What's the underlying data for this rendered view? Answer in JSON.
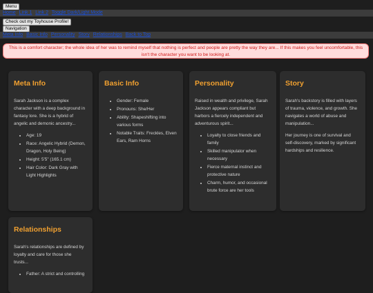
{
  "top": {
    "menu_label": "Menu",
    "links": [
      "Home",
      "Link 1",
      "Link 2",
      "Toggle Dark/Light Mode"
    ],
    "toyhouse_label": "Check out my Toyhouse Profile!",
    "navigation_label": "Navigation",
    "nav_links": [
      "Meta Info",
      "Basic Info",
      "Personality",
      "Story",
      "Relationships",
      "Back to Top"
    ]
  },
  "notice": {
    "text": "This is a comfort character; the whole idea of her was to remind myself that nothing is perfect and people are pretty the way they are... If this makes you feel uncomfortable, this isn't the character you want to be looking at."
  },
  "colors": {
    "background": "#1e1e1e",
    "card": "#2d2d2d",
    "heading": "#f0a030",
    "notice_bg": "#ffdcdc",
    "notice_text": "#d01919",
    "link": "#1a4fd8"
  },
  "cards": {
    "meta": {
      "title": "Meta Info",
      "text": "Sarah Jackson is a complex character with a deep background in fantasy lore. She is a hybrid of angelic and demonic ancestry...",
      "items": [
        "Age: 19",
        "Race: Angelic Hybrid (Demon, Dragon, Holy Being)",
        "Height: 5'5\" (165.1 cm)",
        "Hair Color: Dark Gray with Light Highlights"
      ]
    },
    "basic": {
      "title": "Basic Info",
      "items": [
        "Gender: Female",
        "Pronouns: She/Her",
        "Ability: Shapeshifting into various forms",
        "Notable Traits: Freckles, Elven Ears, Ram Horns"
      ]
    },
    "personality": {
      "title": "Personality",
      "text": "Raised in wealth and privilege, Sarah Jackson appears compliant but harbors a fiercely independent and adventurous spirit...",
      "items": [
        "Loyalty to close friends and family",
        "Skilled manipulator when necessary",
        "Fierce maternal instinct and protective nature",
        "Charm, humor, and occasional brute force are her tools"
      ]
    },
    "story": {
      "title": "Story",
      "text1": "Sarah's backstory is filled with layers of trauma, violence, and growth. She navigates a world of abuse and manipulation...",
      "text2": "Her journey is one of survival and self-discovery, marked by significant hardships and resilience."
    },
    "relationships": {
      "title": "Relationships",
      "text": "Sarah's relationships are defined by loyalty and care for those she trusts...",
      "items": [
        "Father: A strict and controlling"
      ]
    }
  }
}
